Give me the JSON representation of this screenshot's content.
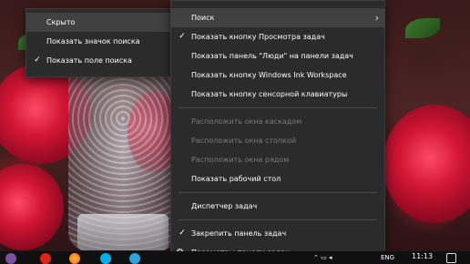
{
  "main_menu": {
    "items": [
      {
        "label": "Поиск",
        "checked": false,
        "submenu": true,
        "disabled": false
      },
      {
        "label": "Показать кнопку Просмотра задач",
        "checked": true,
        "disabled": false
      },
      {
        "label": "Показать панель \"Люди\" на панели задач",
        "checked": false,
        "disabled": false
      },
      {
        "label": "Показать кнопку Windows Ink Workspace",
        "checked": false,
        "disabled": false
      },
      {
        "label": "Показать кнопку сенсорной клавиатуры",
        "checked": false,
        "disabled": false
      },
      {
        "label": "Расположить окна каскадом",
        "checked": false,
        "disabled": true
      },
      {
        "label": "Расположить окна стопкой",
        "checked": false,
        "disabled": true
      },
      {
        "label": "Расположить окна рядом",
        "checked": false,
        "disabled": true
      },
      {
        "label": "Показать рабочий стол",
        "checked": false,
        "disabled": false
      },
      {
        "label": "Диспетчер задач",
        "checked": false,
        "disabled": false
      },
      {
        "label": "Закрепить панель задач",
        "checked": true,
        "disabled": false
      },
      {
        "label": "Параметры панели задач",
        "checked": false,
        "disabled": false,
        "icon": "gear-icon"
      }
    ]
  },
  "search_submenu": {
    "items": [
      {
        "label": "Скрыто",
        "checked": false
      },
      {
        "label": "Показать значок поиска",
        "checked": false
      },
      {
        "label": "Показать поле поиска",
        "checked": true
      }
    ]
  },
  "taskbar": {
    "language": "ENG",
    "time": "11:13",
    "icons": [
      "viber-icon",
      "yandex-icon",
      "firefox-icon",
      "skype-icon",
      "telegram-icon"
    ]
  },
  "colors": {
    "menu_bg": "#2b2b2b",
    "menu_highlight": "#414141",
    "menu_text": "#ffffff",
    "menu_disabled_text": "#7a7a7a",
    "taskbar_bg": "#101010"
  }
}
